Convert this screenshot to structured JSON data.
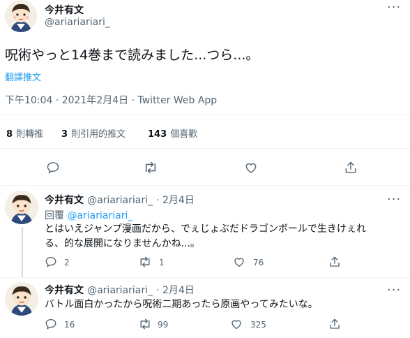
{
  "main_tweet": {
    "author_name": "今井有文",
    "author_handle": "@ariariariari_",
    "text": "呪術やっと14巻まで読みました...つら...。",
    "translate_label": "翻譯推文",
    "timestamp": "下午10:04 · 2021年2月4日 · Twitter Web App",
    "stats": [
      {
        "count": "8",
        "label": "則轉推"
      },
      {
        "count": "3",
        "label": "則引用的推文"
      },
      {
        "count": "143",
        "label": "個喜歡"
      }
    ]
  },
  "replies": [
    {
      "author_name": "今井有文",
      "author_handle": "@ariariariari_",
      "date": "2月4日",
      "reply_label": "回覆",
      "reply_target": "@ariariariari_",
      "text_line1": "とはいえジャンプ漫画だから、でぇじょぶだドラゴンボールで生きけぇれ",
      "text_line2": "る、的な展開になりませんかね...。",
      "reply_count": "2",
      "retweet_count": "1",
      "like_count": "76"
    },
    {
      "author_name": "今井有文",
      "author_handle": "@ariariariari_",
      "date": "2月4日",
      "text_line1": "バトル面白かったから呪術二期あったら原画やってみたいな。",
      "reply_count": "16",
      "retweet_count": "99",
      "like_count": "325"
    }
  ],
  "colors": {
    "link": "#1d9bf0",
    "secondary_text": "#536471",
    "divider": "#eff3f4"
  },
  "icons": [
    "more-icon",
    "reply-icon",
    "retweet-icon",
    "like-icon",
    "share-icon"
  ]
}
